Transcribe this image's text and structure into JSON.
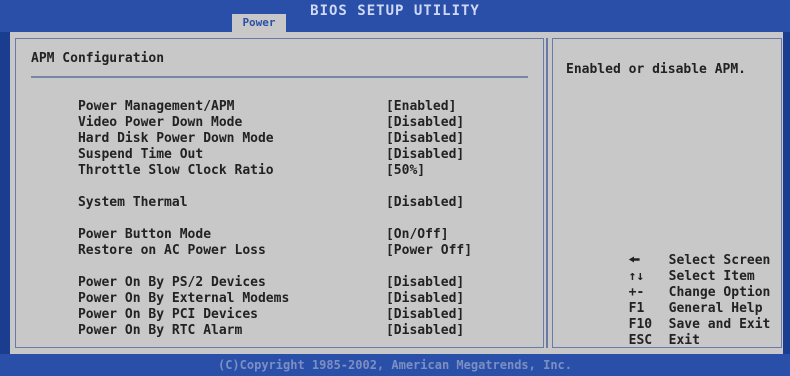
{
  "header": {
    "title": "BIOS SETUP UTILITY",
    "active_tab": "Power"
  },
  "section": {
    "title": "APM Configuration"
  },
  "items": [
    {
      "label": "Power Management/APM",
      "value": "[Enabled]"
    },
    {
      "label": "Video Power Down Mode",
      "value": "[Disabled]"
    },
    {
      "label": "Hard Disk Power Down Mode",
      "value": "[Disabled]"
    },
    {
      "label": "Suspend Time Out",
      "value": "[Disabled]"
    },
    {
      "label": "Throttle Slow Clock Ratio",
      "value": "[50%]"
    },
    {
      "label": "System Thermal",
      "value": "[Disabled]"
    },
    {
      "label": "Power Button Mode",
      "value": "[On/Off]"
    },
    {
      "label": "Restore on AC Power Loss",
      "value": "[Power Off]"
    },
    {
      "label": "Power On By PS/2 Devices",
      "value": "[Disabled]"
    },
    {
      "label": "Power On By External Modems",
      "value": "[Disabled]"
    },
    {
      "label": "Power On By PCI Devices",
      "value": "[Disabled]"
    },
    {
      "label": "Power On By RTC Alarm",
      "value": "[Disabled]"
    }
  ],
  "help": {
    "text": "Enabled or disable APM."
  },
  "keys": [
    {
      "key": "🠘",
      "action": "Select Screen",
      "icon": "arrow-left-right-icon"
    },
    {
      "key": "↑↓",
      "action": "Select Item",
      "icon": "arrow-up-down-icon"
    },
    {
      "key": "+-",
      "action": "Change Option"
    },
    {
      "key": "F1",
      "action": "General Help"
    },
    {
      "key": "F10",
      "action": "Save and Exit"
    },
    {
      "key": "ESC",
      "action": "Exit"
    }
  ],
  "footer": {
    "text": "(C)Copyright 1985-2002, American Megatrends, Inc."
  },
  "colors": {
    "background": "#1a3d8f",
    "titlebar": "#2a4fa8",
    "panel": "#c8c8c8",
    "text": "#222222"
  }
}
